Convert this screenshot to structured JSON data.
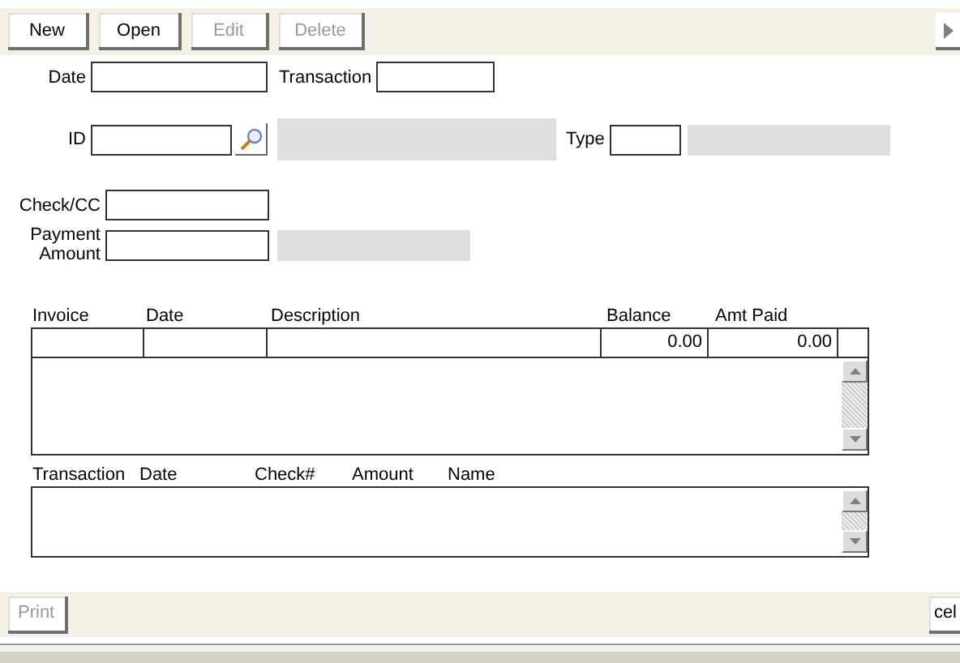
{
  "toolbar": {
    "buttons": [
      {
        "label": "New",
        "disabled": false
      },
      {
        "label": "Open",
        "disabled": false
      },
      {
        "label": "Edit",
        "disabled": true
      },
      {
        "label": "Delete",
        "disabled": true
      }
    ]
  },
  "form": {
    "date_label": "Date",
    "transaction_label": "Transaction",
    "id_label": "ID",
    "type_label": "Type",
    "check_label": "Check/CC",
    "payment_label": "Payment Amount"
  },
  "invoices": {
    "columns": [
      "Invoice",
      "Date",
      "Description",
      "Balance",
      "Amt Paid"
    ],
    "rows": [
      [
        "",
        "",
        "",
        "0.00",
        "0.00"
      ]
    ]
  },
  "payments": {
    "columns": [
      "Transaction",
      "Date",
      "Check#",
      "Amount",
      "Name"
    ]
  },
  "footer": {
    "buttons": [
      {
        "label": "Print",
        "disabled": true
      },
      {
        "label": "cel",
        "disabled": false
      }
    ]
  }
}
